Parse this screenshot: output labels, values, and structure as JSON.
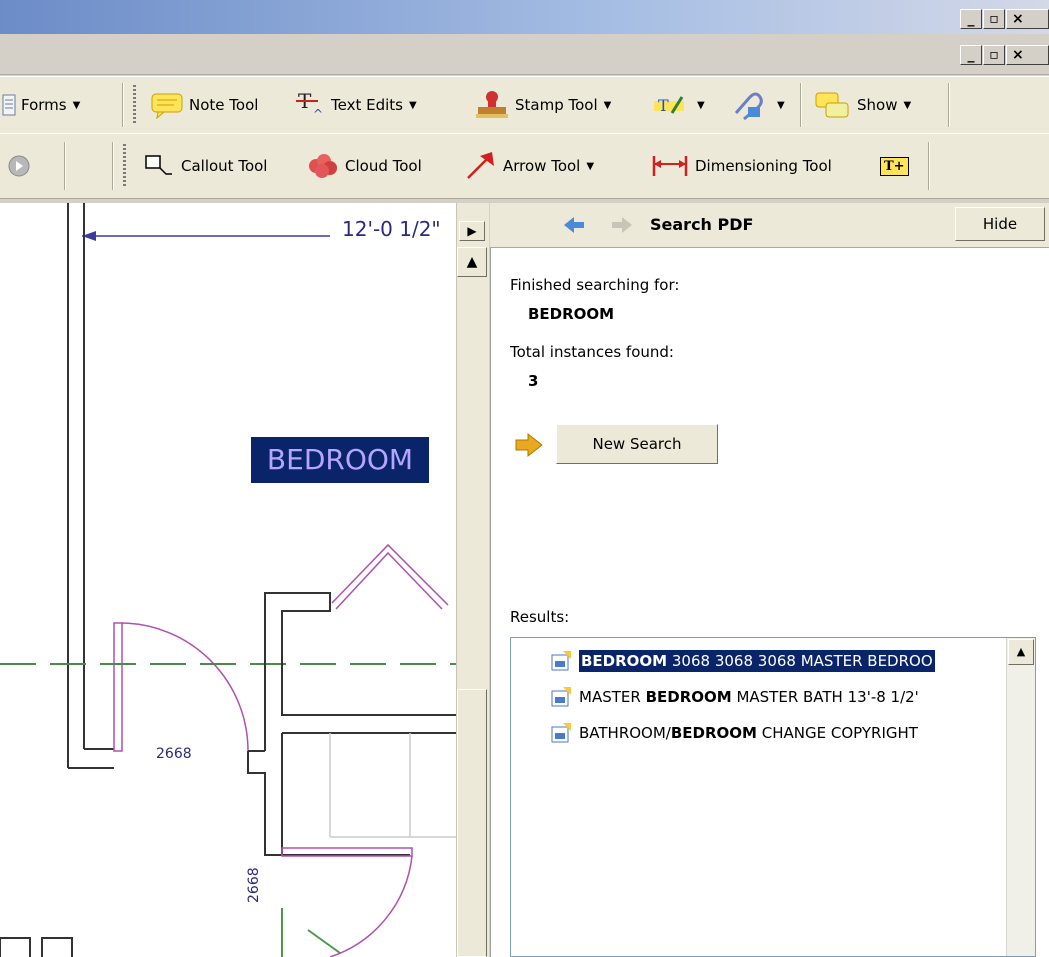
{
  "window": {
    "min": "_",
    "restore": "▫",
    "close": "×"
  },
  "toolbar1": {
    "forms": "Forms",
    "note_tool": "Note Tool",
    "text_edits": "Text Edits",
    "stamp_tool": "Stamp Tool",
    "show": "Show"
  },
  "toolbar2": {
    "callout_tool": "Callout Tool",
    "cloud_tool": "Cloud Tool",
    "arrow_tool": "Arrow Tool",
    "dimensioning_tool": "Dimensioning Tool",
    "text_box_glyph": "T+"
  },
  "drawing": {
    "dimension_label": "12'-0 1/2\"",
    "highlight_text": "BEDROOM",
    "door_label_1": "2668",
    "door_label_2": "2668"
  },
  "search_panel": {
    "title": "Search PDF",
    "hide_label": "Hide",
    "finished_label": "Finished searching for:",
    "search_term": "BEDROOM",
    "total_label": "Total instances found:",
    "total_count": "3",
    "new_search_label": "New Search",
    "results_label": "Results:",
    "results": [
      {
        "pre": "",
        "match": "BEDROOM",
        "post": " 3068 3068 3068 MASTER BEDROO"
      },
      {
        "pre": "MASTER ",
        "match": "BEDROOM",
        "post": " MASTER BATH 13'-8 1/2'"
      },
      {
        "pre": "BATHROOM/",
        "match": "BEDROOM",
        "post": " CHANGE COPYRIGHT"
      }
    ]
  },
  "colors": {
    "highlight_bg": "#0a246a",
    "highlight_fg": "#b4a6ff",
    "dim_line": "#3a3aa0",
    "door": "#b050b0"
  }
}
